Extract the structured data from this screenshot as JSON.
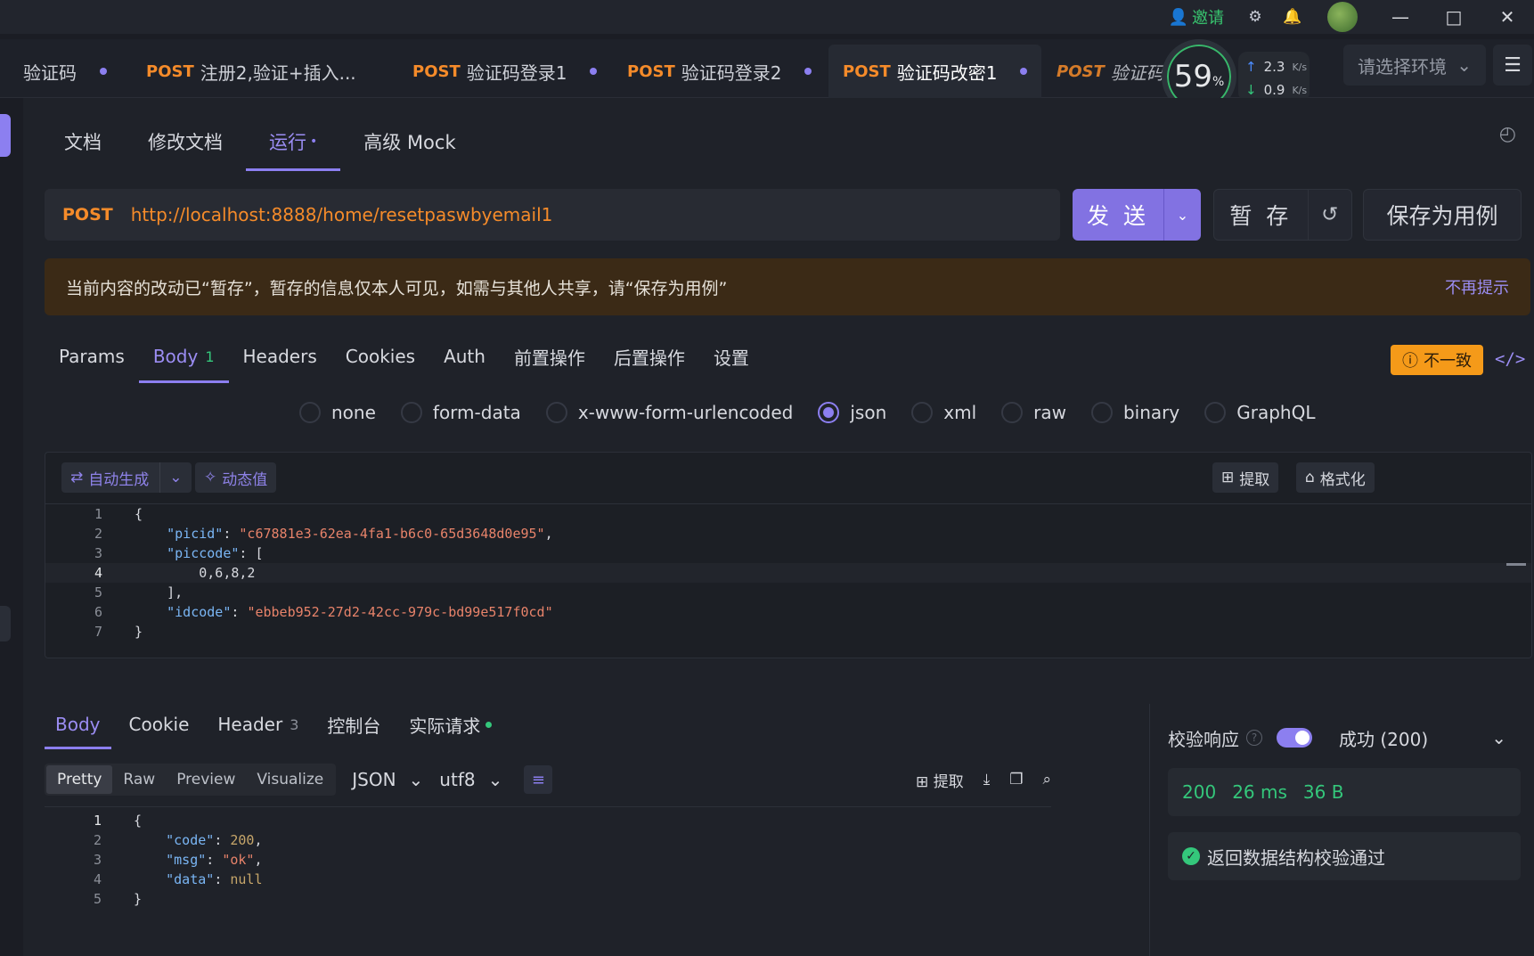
{
  "titlebar": {
    "invite": "邀请"
  },
  "tabs": [
    {
      "method": "",
      "name": "验证码"
    },
    {
      "method": "POST",
      "name": "注册2,验证+插入..."
    },
    {
      "method": "POST",
      "name": "验证码登录1"
    },
    {
      "method": "POST",
      "name": "验证码登录2"
    },
    {
      "method": "POST",
      "name": "验证码改密1"
    },
    {
      "method": "POST",
      "name": "验证码改"
    }
  ],
  "network": {
    "percent": "59",
    "unit": "%",
    "up": "2.3",
    "down": "0.9",
    "rate_unit": "K/s"
  },
  "env": {
    "placeholder": "请选择环境"
  },
  "subtabs": [
    "文档",
    "修改文档",
    "运行",
    "高级 Mock"
  ],
  "request": {
    "method": "POST",
    "url": "http://localhost:8888/home/resetpaswbyemail1",
    "send": "发 送",
    "save_temp": "暂 存",
    "save_case": "保存为用例"
  },
  "notice": {
    "text": "当前内容的改动已“暂存”，暂存的信息仅本人可见，如需与其他人共享，请“保存为用例”",
    "dismiss": "不再提示"
  },
  "req_tabs": [
    {
      "label": "Params",
      "badge": ""
    },
    {
      "label": "Body",
      "badge": "1"
    },
    {
      "label": "Headers",
      "badge": ""
    },
    {
      "label": "Cookies",
      "badge": ""
    },
    {
      "label": "Auth",
      "badge": ""
    },
    {
      "label": "前置操作",
      "badge": ""
    },
    {
      "label": "后置操作",
      "badge": ""
    },
    {
      "label": "设置",
      "badge": ""
    }
  ],
  "inconsistent": "不一致",
  "body_types": [
    "none",
    "form-data",
    "x-www-form-urlencoded",
    "json",
    "xml",
    "raw",
    "binary",
    "GraphQL"
  ],
  "body_selected": "json",
  "editor": {
    "auto_generate": "自动生成",
    "dynamic_value": "动态值",
    "extract": "提取",
    "format": "格式化",
    "lines": [
      "{",
      "    \"picid\": \"c67881e3-62ea-4fa1-b6c0-65d3648d0e95\",",
      "    \"piccode\": [",
      "        0,6,8,2",
      "    ],",
      "    \"idcode\": \"ebbeb952-27d2-42cc-979c-bd99e517f0cd\"",
      "}"
    ]
  },
  "response": {
    "tabs": [
      {
        "label": "Body",
        "badge": ""
      },
      {
        "label": "Cookie",
        "badge": ""
      },
      {
        "label": "Header",
        "badge": "3"
      },
      {
        "label": "控制台",
        "badge": ""
      },
      {
        "label": "实际请求",
        "badge": ""
      }
    ],
    "views": [
      "Pretty",
      "Raw",
      "Preview",
      "Visualize"
    ],
    "format": "JSON",
    "encoding": "utf8",
    "extract": "提取",
    "lines": [
      "{",
      "    \"code\": 200,",
      "    \"msg\": \"ok\",",
      "    \"data\": null",
      "}"
    ]
  },
  "validation": {
    "label": "校验响应",
    "status": "成功 (200)",
    "code": "200",
    "time": "26 ms",
    "size": "36 B",
    "pass_text": "返回数据结构校验通过"
  },
  "colors": {
    "accent": "#8c7ff0",
    "method": "#f58b2a",
    "success": "#34c77b",
    "warning": "#f59a19"
  }
}
